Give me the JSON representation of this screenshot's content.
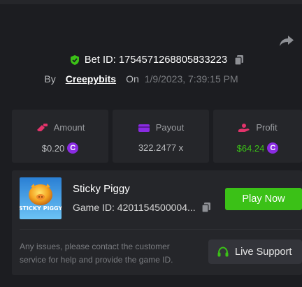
{
  "bet": {
    "id_text": "Bet ID: 1754571268805833223",
    "by_label": "By",
    "author": "Creepybits",
    "on_label": "On",
    "date": "1/9/2023, 7:39:15 PM"
  },
  "stats": [
    {
      "label": "Amount",
      "value": "$0.20",
      "icon": "amount-icon"
    },
    {
      "label": "Payout",
      "value": "322.2477 x",
      "icon": "wallet-icon"
    },
    {
      "label": "Profit",
      "value": "$64.24",
      "icon": "profit-hand-icon"
    }
  ],
  "game": {
    "title": "Sticky Piggy",
    "id_text": "Game ID: 4201154500004...",
    "thumb_text": "STICKY PIGGY",
    "play_label": "Play Now",
    "issues_text": "Any issues, please contact the customer service for help and provide the game ID.",
    "support_label": "Live Support"
  },
  "colors": {
    "accent_green": "#3bc117",
    "coin_purple": "#8a2be2",
    "panel": "#25262a",
    "background": "#1c1d21"
  }
}
